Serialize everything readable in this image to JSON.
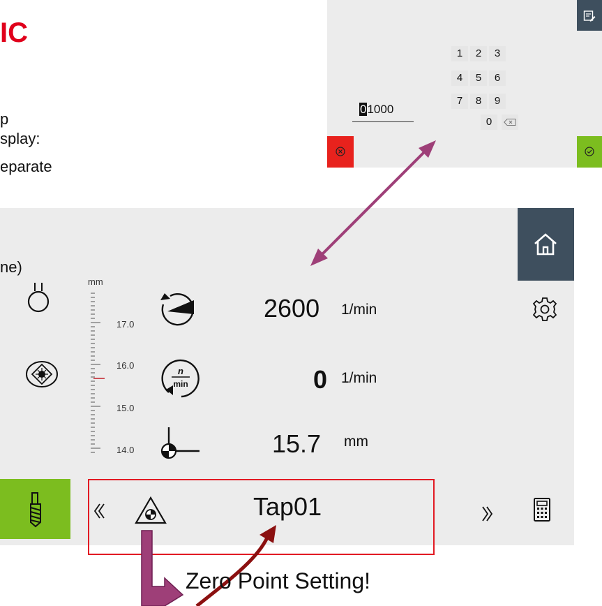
{
  "slide": {
    "title_fragment": "IC",
    "line1": "p",
    "line2": "splay:",
    "line3": "eparate",
    "line4": "ne)",
    "annotation": "Zero Point Setting!"
  },
  "keypad": {
    "value_first_digit": "0",
    "value_rest": "1000",
    "keys": [
      "1",
      "2",
      "3",
      "4",
      "5",
      "6",
      "7",
      "8",
      "9",
      "0"
    ]
  },
  "machine": {
    "scale": {
      "unit": "mm",
      "ticks": [
        "17.0",
        "16.0",
        "15.0",
        "14.0"
      ]
    },
    "speed": {
      "value": "2600",
      "unit": "1/min"
    },
    "actual": {
      "value": "0",
      "unit": "1/min"
    },
    "depth": {
      "value": "15.7",
      "unit": "mm"
    },
    "program": {
      "name": "Tap01"
    },
    "speed_icon_label_n": "n",
    "speed_icon_label_min": "min"
  },
  "colors": {
    "accent_red": "#e21a23",
    "accent_green": "#7cbd1f",
    "dark_panel": "#3e4f5e",
    "arrow_purple": "#9e3f78",
    "arrow_darkred": "#8b1010"
  }
}
